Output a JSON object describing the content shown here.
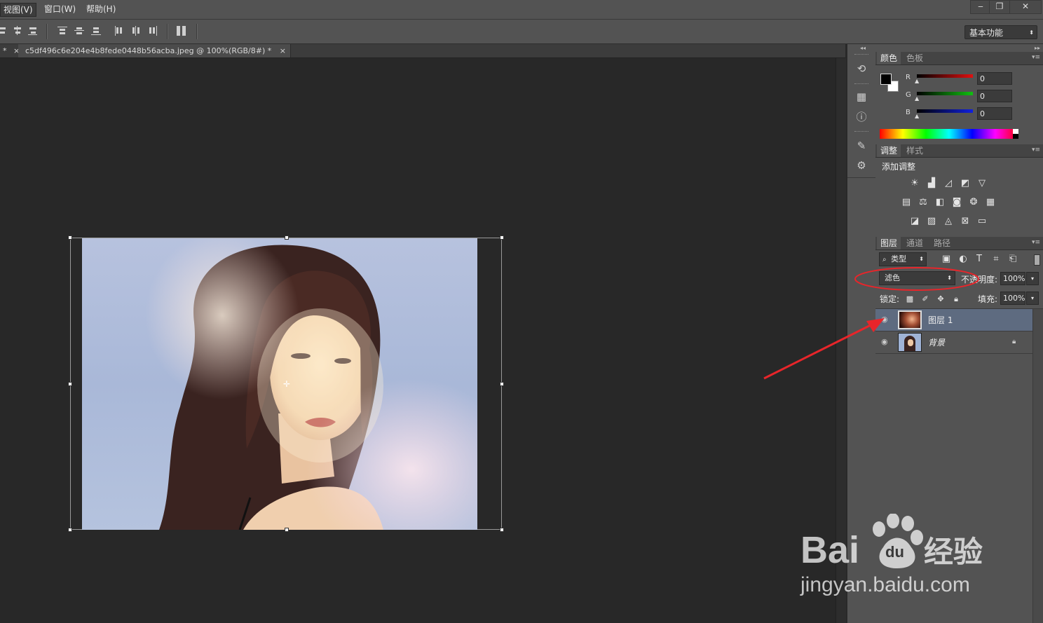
{
  "menu": {
    "items": [
      {
        "label": "视图(V)",
        "active": true
      },
      {
        "label": "窗口(W)",
        "active": false
      },
      {
        "label": "帮助(H)",
        "active": false
      }
    ],
    "window_controls": [
      "minimize-icon",
      "restore-icon",
      "close-icon"
    ]
  },
  "options_bar": {
    "workspace": "基本功能",
    "align_icons": [
      "align-top-icon",
      "align-vcenter-icon",
      "align-bottom-icon",
      "distribute-top-icon",
      "distribute-vcenter-icon",
      "distribute-bottom-icon",
      "distribute-left-icon",
      "distribute-hcenter-icon",
      "distribute-right-icon",
      "auto-align-icon"
    ]
  },
  "tabs": {
    "first_tab_label": "*",
    "active_tab_label": "c5df496c6e204e4b8fede0448b56acba.jpeg @ 100%(RGB/8#) *",
    "close_glyph": "×"
  },
  "color_panel": {
    "tabs": [
      "颜色",
      "色板"
    ],
    "channels": [
      {
        "label": "R",
        "value": "0",
        "color": "#e01010"
      },
      {
        "label": "G",
        "value": "0",
        "color": "#10c010"
      },
      {
        "label": "B",
        "value": "0",
        "color": "#1020e0"
      }
    ],
    "foreground": "#000000",
    "background": "#ffffff"
  },
  "adjustments_panel": {
    "tabs": [
      "调整",
      "样式"
    ],
    "heading": "添加调整",
    "icons_row1": [
      "brightness-icon",
      "levels-icon",
      "curves-icon",
      "exposure-icon",
      "vibrance-icon"
    ],
    "icons_row2": [
      "hue-saturation-icon",
      "color-balance-icon",
      "black-white-icon",
      "photo-filter-icon",
      "channel-mixer-icon",
      "color-lookup-icon"
    ],
    "icons_row3": [
      "invert-icon",
      "posterize-icon",
      "threshold-icon",
      "selective-color-icon",
      "gradient-map-icon"
    ]
  },
  "layers_panel": {
    "tabs": [
      "图层",
      "通道",
      "路径"
    ],
    "filter_kind": "类型",
    "blend_mode": "滤色",
    "opacity_label": "不透明度:",
    "opacity_value": "100%",
    "lock_label": "锁定:",
    "fill_label": "填充:",
    "fill_value": "100%",
    "layers": [
      {
        "name": "图层 1",
        "selected": true,
        "locked": false
      },
      {
        "name": "背景",
        "selected": false,
        "locked": true
      }
    ]
  },
  "watermark": {
    "logo_text_a": "Bai",
    "logo_text_b": "du",
    "logo_text_c": "经验",
    "url": "jingyan.baidu.com"
  },
  "annotation_color": "#e8252a"
}
